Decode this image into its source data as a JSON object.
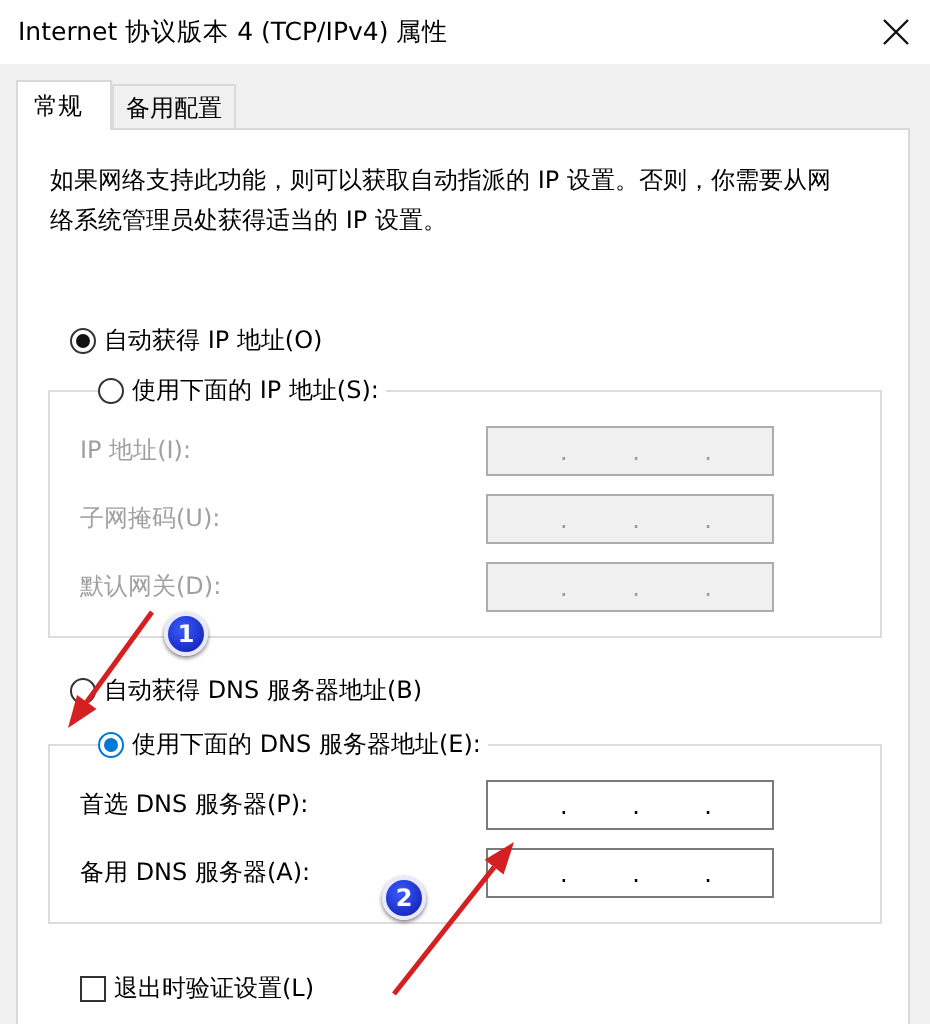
{
  "window": {
    "title": "Internet 协议版本 4 (TCP/IPv4) 属性"
  },
  "tabs": [
    {
      "label": "常规",
      "selected": true
    },
    {
      "label": "备用配置",
      "selected": false
    }
  ],
  "description": "如果网络支持此功能，则可以获取自动指派的 IP 设置。否则，你需要从网络系统管理员处获得适当的 IP 设置。",
  "ip_section": {
    "auto_radio": {
      "label": "自动获得 IP 地址(O)",
      "selected": true,
      "focused": false
    },
    "manual_radio": {
      "label": "使用下面的 IP 地址(S):",
      "selected": false,
      "focused": false
    },
    "fields": [
      {
        "label": "IP 地址(I):",
        "disabled": true,
        "separators": [
          ".",
          ".",
          "."
        ]
      },
      {
        "label": "子网掩码(U):",
        "disabled": true,
        "separators": [
          ".",
          ".",
          "."
        ]
      },
      {
        "label": "默认网关(D):",
        "disabled": true,
        "separators": [
          ".",
          ".",
          "."
        ]
      }
    ]
  },
  "dns_section": {
    "auto_radio": {
      "label": "自动获得 DNS 服务器地址(B)",
      "selected": false,
      "focused": false
    },
    "manual_radio": {
      "label": "使用下面的 DNS 服务器地址(E):",
      "selected": true,
      "focused": true
    },
    "fields": [
      {
        "label": "首选 DNS 服务器(P):",
        "disabled": false,
        "separators": [
          ".",
          ".",
          "."
        ]
      },
      {
        "label": "备用 DNS 服务器(A):",
        "disabled": false,
        "separators": [
          ".",
          ".",
          "."
        ]
      }
    ]
  },
  "validate_checkbox": {
    "label": "退出时验证设置(L)",
    "checked": false
  },
  "annotations": [
    {
      "kind": "arrow"
    },
    {
      "kind": "badge",
      "number": "1"
    },
    {
      "kind": "arrow"
    },
    {
      "kind": "badge",
      "number": "2"
    }
  ]
}
